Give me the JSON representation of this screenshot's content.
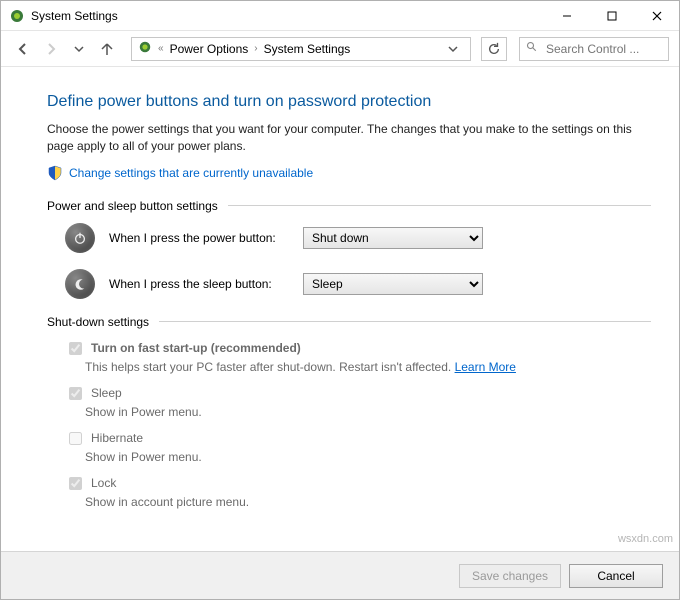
{
  "window": {
    "title": "System Settings"
  },
  "breadcrumb": {
    "item1": "Power Options",
    "item2": "System Settings"
  },
  "search": {
    "placeholder": "Search Control ..."
  },
  "page": {
    "heading": "Define power buttons and turn on password protection",
    "description": "Choose the power settings that you want for your computer. The changes that you make to the settings on this page apply to all of your power plans.",
    "change_link": "Change settings that are currently unavailable"
  },
  "group1": {
    "title": "Power and sleep button settings",
    "power_label": "When I press the power button:",
    "power_value": "Shut down",
    "sleep_label": "When I press the sleep button:",
    "sleep_value": "Sleep"
  },
  "group2": {
    "title": "Shut-down settings",
    "fast": {
      "label": "Turn on fast start-up (recommended)",
      "desc": "This helps start your PC faster after shut-down. Restart isn't affected. ",
      "link": "Learn More"
    },
    "sleep": {
      "label": "Sleep",
      "desc": "Show in Power menu."
    },
    "hibernate": {
      "label": "Hibernate",
      "desc": "Show in Power menu."
    },
    "lock": {
      "label": "Lock",
      "desc": "Show in account picture menu."
    }
  },
  "footer": {
    "save": "Save changes",
    "cancel": "Cancel"
  },
  "watermark": "wsxdn.com"
}
